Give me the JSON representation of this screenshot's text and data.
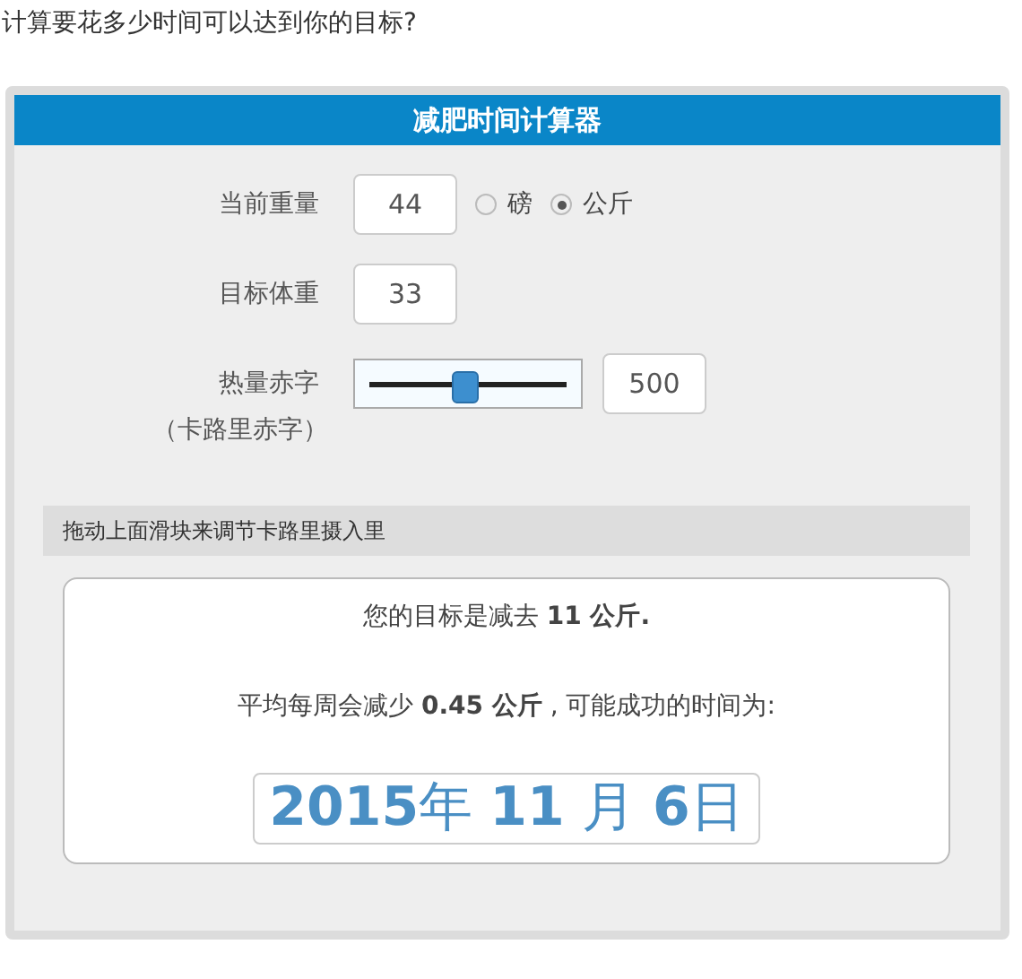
{
  "question": "计算要花多少时间可以达到你的目标?",
  "calculator": {
    "title": "减肥时间计算器",
    "current_weight": {
      "label": "当前重量",
      "value": "44",
      "units": [
        {
          "label": "磅",
          "selected": false
        },
        {
          "label": "公斤",
          "selected": true
        }
      ]
    },
    "target_weight": {
      "label": "目标体重",
      "value": "33"
    },
    "calorie_deficit": {
      "label": "热量赤字",
      "sublabel": "（卡路里赤字）",
      "level": 0.48,
      "value": "500"
    },
    "hint": "拖动上面滑块来调节卡路里摄入里",
    "result": {
      "goal": "您的目标是减去 **11 公斤.**",
      "weekly": "平均每周会减少 **0.45 公斤** , 可能成功的时间为:",
      "date": "**2015**年 **11** 月 **6**日"
    }
  }
}
